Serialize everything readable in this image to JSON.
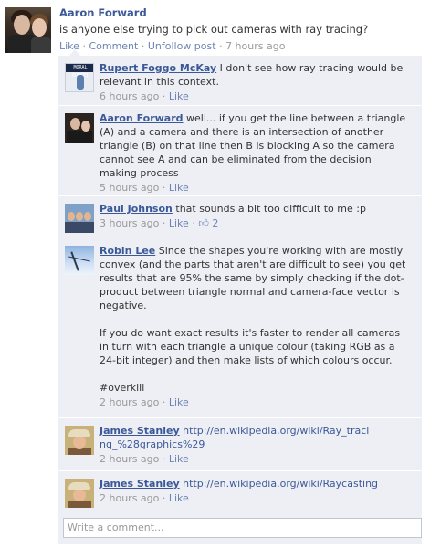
{
  "post": {
    "author": "Aaron Forward",
    "text": "is anyone else trying to pick out cameras with ray tracing?",
    "actions": {
      "like": "Like",
      "comment": "Comment",
      "unfollow": "Unfollow post",
      "time": "7 hours ago"
    }
  },
  "comments": [
    {
      "author": "Rupert Foggo McKay",
      "text": "I don't see how ray tracing would be relevant in this context.",
      "time": "6 hours ago",
      "like": "Like",
      "avatar_text": "MORAL RUNSET"
    },
    {
      "author": "Aaron Forward",
      "text": "well... if you get the line between a triangle (A) and a camera and there is an intersection of another triangle (B) on that line then B is blocking A so the camera cannot see A and can be eliminated from the decision making process",
      "time": "5 hours ago",
      "like": "Like"
    },
    {
      "author": "Paul Johnson",
      "text": "that sounds a bit too difficult to me :p",
      "time": "3 hours ago",
      "like": "Like",
      "likes_count": "2"
    },
    {
      "author": "Robin Lee",
      "text_p1": "Since the shapes you're working with are mostly convex (and the parts that aren't are difficult to see) you get results that are 95% the same by simply checking if the dot-product between triangle normal and camera-face vector is negative.",
      "text_p2": "If you do want exact results it's faster to render all cameras in turn with each triangle a unique colour (taking RGB as a 24-bit integer) and then make lists of which colours occur.",
      "text_p3": "#overkill",
      "time": "2 hours ago",
      "like": "Like"
    },
    {
      "author": "James Stanley",
      "link": "http://en.wikipedia.org/wiki/Ray_tracing_%28graphics%29",
      "time": "2 hours ago",
      "like": "Like"
    },
    {
      "author": "James Stanley",
      "link": "http://en.wikipedia.org/wiki/Raycasting",
      "time": "2 hours ago",
      "like": "Like"
    }
  ],
  "write_comment": {
    "placeholder": "Write a comment..."
  }
}
